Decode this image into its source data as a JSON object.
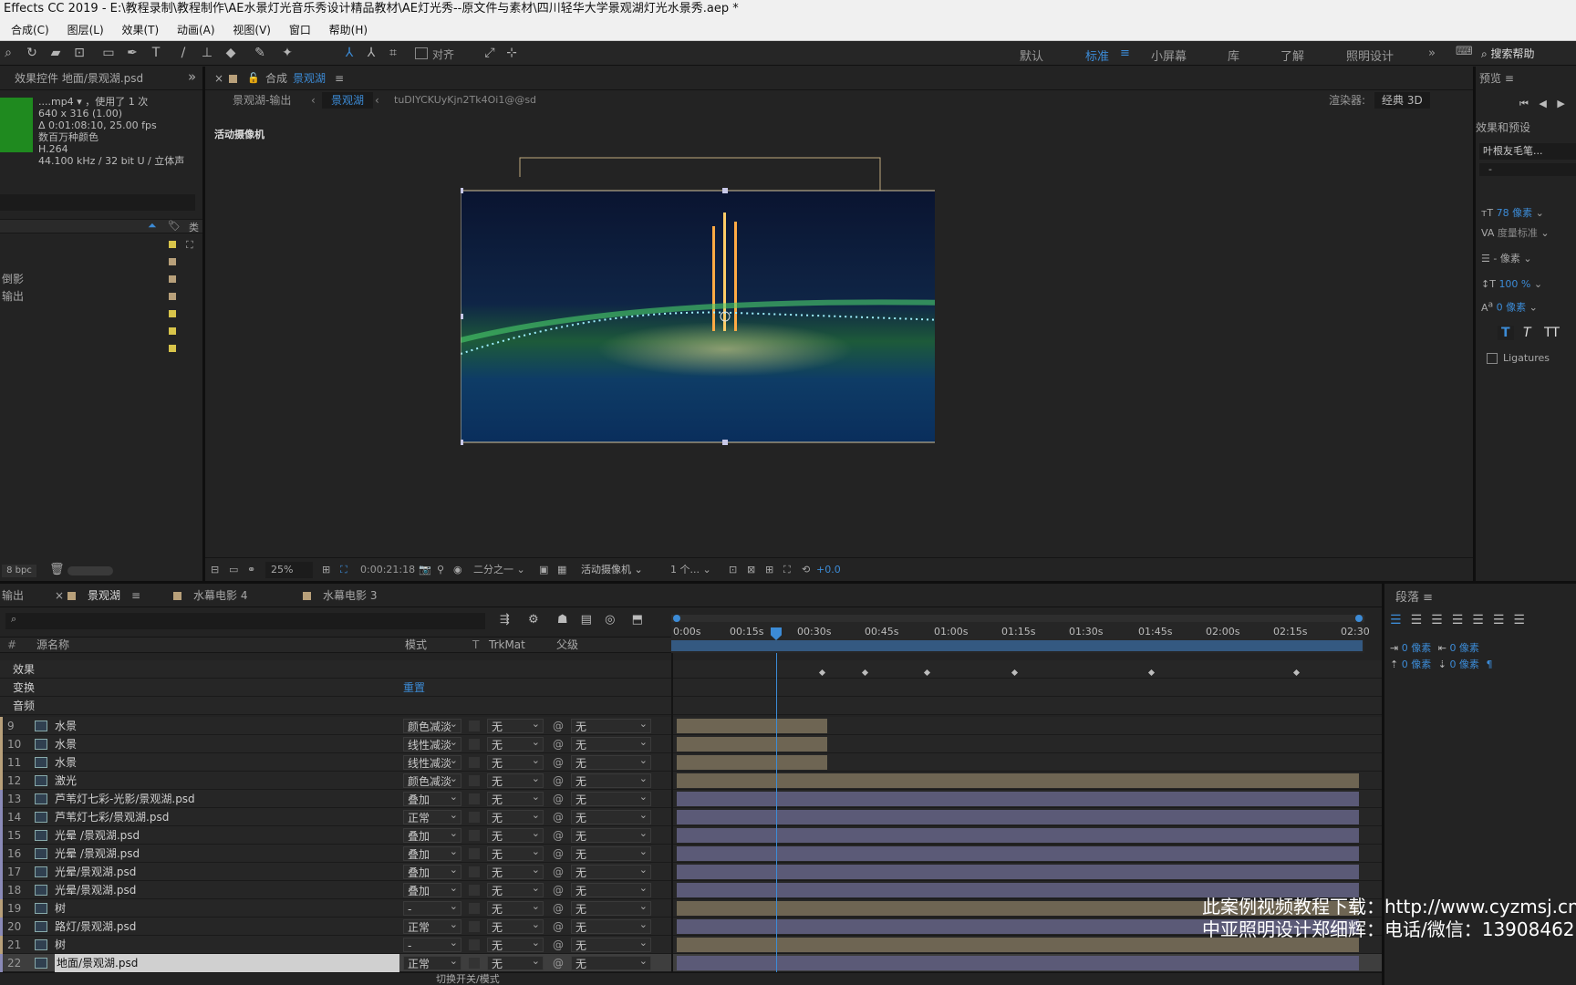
{
  "window": {
    "title": "Effects CC 2019 - E:\\教程录制\\教程制作\\AE水景灯光音乐秀设计精品教材\\AE灯光秀--原文件与素材\\四川轻华大学景观湖灯光水景秀.aep *"
  },
  "menu": [
    "合成(C)",
    "图层(L)",
    "效果(T)",
    "动画(A)",
    "视图(V)",
    "窗口",
    "帮助(H)"
  ],
  "toolbar": {
    "align_label": "对齐",
    "workspaces": [
      "默认",
      "标准",
      "小屏幕",
      "库",
      "了解",
      "照明设计"
    ],
    "active_workspace": "标准",
    "search_placeholder": "搜索帮助"
  },
  "project_panel": {
    "tab_label": "效果控件 地面/景观湖.psd",
    "file_name": "....mp4",
    "usage": "，使用了 1 次",
    "size": "640 x 316 (1.00)",
    "duration": "Δ 0:01:08:10, 25.00 fps",
    "colors": "数百万种颜色",
    "codec": "H.264",
    "audio": "44.100 kHz / 32 bit U / 立体声",
    "col_type": "类",
    "items": [
      "",
      "",
      "倒影",
      "输出",
      "",
      "",
      ""
    ],
    "item_colors": [
      "#d8c44a",
      "#b8a07a",
      "#b8a07a",
      "#b8a07a",
      "#d8c44a",
      "#d8c44a",
      "#d8c44a"
    ],
    "bpc": "8 bpc"
  },
  "comp_panel": {
    "tab_prefix": "合成",
    "tab_name": "景观湖",
    "crumbs": [
      "景观湖-输出",
      "景观湖"
    ],
    "extra_crumb": "tuDIYCKUyKjn2Tk4Oi1@@sd",
    "renderer_label": "渲染器:",
    "renderer_value": "经典 3D",
    "active_camera": "活动摄像机",
    "zoom": "25%",
    "timecode": "0:00:21:18",
    "resolution": "二分之一",
    "camera_select": "活动摄像机",
    "views": "1 个...",
    "exposure": "+0.0"
  },
  "right_panel": {
    "preview_label": "预览",
    "effects_label": "效果和预设",
    "font_name": "叶根友毛笔...",
    "font_style": "-",
    "font_size": "78 像素",
    "kerning": "度量标准",
    "leading": "- 像素",
    "vert_scale": "100 %",
    "baseline": "0 像素",
    "ligatures": "Ligatures",
    "paragraph_label": "段落",
    "indent1": "0 像素",
    "indent2": "0 像素",
    "indent3": "0 像素",
    "space1": "0 像素",
    "space2": "0 像素"
  },
  "timeline": {
    "tabs": [
      "输出",
      "景观湖",
      "水幕电影 4",
      "水幕电影 3"
    ],
    "active_tab": "景观湖",
    "col_num": "#",
    "col_name": "源名称",
    "col_mode": "模式",
    "col_t": "T",
    "col_trkmat": "TrkMat",
    "col_parent": "父级",
    "ruler": [
      "0:00s",
      "00:15s",
      "00:30s",
      "00:45s",
      "01:00s",
      "01:15s",
      "01:30s",
      "01:45s",
      "02:00s",
      "02:15s",
      "02:30"
    ],
    "groups": [
      {
        "label": "效果",
        "value": ""
      },
      {
        "label": "变换",
        "value": "重置"
      },
      {
        "label": "音频",
        "value": ""
      }
    ],
    "layers": [
      {
        "num": "9",
        "name": "水景",
        "mode": "颜色减淡",
        "trk": "无",
        "parent": "无",
        "bar": "tan",
        "end": 0.22
      },
      {
        "num": "10",
        "name": "水景",
        "mode": "线性减淡",
        "trk": "无",
        "parent": "无",
        "bar": "tan",
        "end": 0.22
      },
      {
        "num": "11",
        "name": "水景",
        "mode": "线性减淡",
        "trk": "无",
        "parent": "无",
        "bar": "tan",
        "end": 0.22
      },
      {
        "num": "12",
        "name": "激光",
        "mode": "颜色减淡",
        "trk": "无",
        "parent": "无",
        "bar": "tan",
        "end": 1
      },
      {
        "num": "13",
        "name": "芦苇灯七彩-光影/景观湖.psd",
        "mode": "叠加",
        "trk": "无",
        "parent": "无",
        "bar": "lav",
        "end": 1
      },
      {
        "num": "14",
        "name": "芦苇灯七彩/景观湖.psd",
        "mode": "正常",
        "trk": "无",
        "parent": "无",
        "bar": "lav",
        "end": 1
      },
      {
        "num": "15",
        "name": "光晕 /景观湖.psd",
        "mode": "叠加",
        "trk": "无",
        "parent": "无",
        "bar": "lav",
        "end": 1
      },
      {
        "num": "16",
        "name": "光晕 /景观湖.psd",
        "mode": "叠加",
        "trk": "无",
        "parent": "无",
        "bar": "lav",
        "end": 1
      },
      {
        "num": "17",
        "name": "光晕/景观湖.psd",
        "mode": "叠加",
        "trk": "无",
        "parent": "无",
        "bar": "lav",
        "end": 1
      },
      {
        "num": "18",
        "name": "光晕/景观湖.psd",
        "mode": "叠加",
        "trk": "无",
        "parent": "无",
        "bar": "lav",
        "end": 1
      },
      {
        "num": "19",
        "name": "树",
        "mode": "-",
        "trk": "无",
        "parent": "无",
        "bar": "tan",
        "end": 1
      },
      {
        "num": "20",
        "name": "路灯/景观湖.psd",
        "mode": "正常",
        "trk": "无",
        "parent": "无",
        "bar": "lav",
        "end": 1
      },
      {
        "num": "21",
        "name": "树",
        "mode": "-",
        "trk": "无",
        "parent": "无",
        "bar": "tan",
        "end": 1
      },
      {
        "num": "22",
        "name": "地面/景观湖.psd",
        "mode": "正常",
        "trk": "无",
        "parent": "无",
        "bar": "lav",
        "end": 1
      }
    ],
    "footer_label": "切换开关/模式"
  },
  "watermark": {
    "line1": "此案例视频教程下载：http://www.cyzmsj.cn",
    "line2": "中亚照明设计郑细辉：电话/微信：13908462"
  }
}
